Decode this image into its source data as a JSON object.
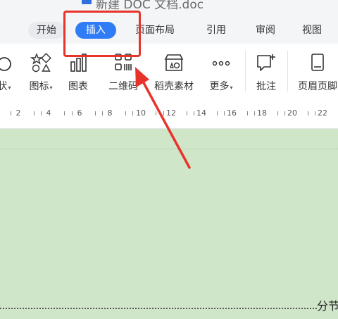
{
  "window": {
    "title": "新建 DOC 文档.doc"
  },
  "tabs": [
    {
      "label": "开始"
    },
    {
      "label": "插入"
    },
    {
      "label": "页面布局"
    },
    {
      "label": "引用"
    },
    {
      "label": "审阅"
    },
    {
      "label": "视图"
    }
  ],
  "toolbar": {
    "shape_label": "状",
    "icons_label": "图标",
    "chart_label": "图表",
    "qrcode_label": "二维码",
    "material_label": "稻壳素材",
    "more_label": "更多",
    "comment_label": "批注",
    "header_label": "页眉页脚",
    "caret": "▾"
  },
  "ruler": {
    "ticks": [
      "2",
      "4",
      "6",
      "8",
      "10",
      "12",
      "14",
      "16",
      "18",
      "20",
      "22"
    ]
  },
  "document": {
    "section_break": "分节"
  },
  "colors": {
    "accent": "#2f7cf6",
    "annotation": "#e8332a",
    "page_bg": "#cfe6c9"
  }
}
